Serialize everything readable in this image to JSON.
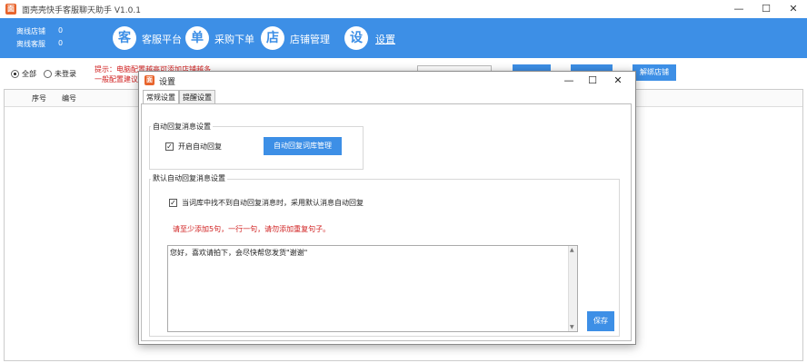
{
  "window": {
    "title": "面壳壳快手客服聊天助手 V1.0.1",
    "icon": "app-logo-icon",
    "minimize": "—",
    "maximize": "☐",
    "close": "✕"
  },
  "header": {
    "offline_shops_label": "离线店铺",
    "offline_shops_value": "0",
    "offline_agents_label": "离线客服",
    "offline_agents_value": "0",
    "nav": [
      {
        "glyph": "客",
        "label": "客服平台"
      },
      {
        "glyph": "单",
        "label": "采购下单"
      },
      {
        "glyph": "店",
        "label": "店铺管理"
      },
      {
        "glyph": "设",
        "label": "设置"
      }
    ]
  },
  "toolbar": {
    "radio_all": "全部",
    "radio_not_logged": "未登录",
    "hint_line1": "提示：电脑配置越高可添加店铺越多",
    "hint_line2": "一般配置建议",
    "unbind_button": "解绑店铺"
  },
  "table": {
    "columns": [
      "序号",
      "编号"
    ]
  },
  "dialog": {
    "title": "设置",
    "minimize": "—",
    "maximize": "☐",
    "close": "✕",
    "tabs": [
      "常规设置",
      "提醒设置"
    ],
    "auto_reply_group": {
      "label": "自动回复消息设置",
      "enable_label": "开启自动回复",
      "enable_checked": true,
      "manage_button": "自动回复词库管理"
    },
    "default_reply_group": {
      "label": "默认自动回复消息设置",
      "fallback_label": "当词库中找不到自动回复消息时，采用默认消息自动回复",
      "fallback_checked": true,
      "warning": "请至少添加5句，一行一句，请勿添加重复句子。",
      "textarea_value": "您好，喜欢请拍下，会尽快帮您发货\"谢谢\"",
      "save_button": "保存"
    }
  },
  "colors": {
    "brand_blue": "#3d8fe6",
    "warning_red": "#d02020",
    "icon_orange": "#e8642c"
  }
}
